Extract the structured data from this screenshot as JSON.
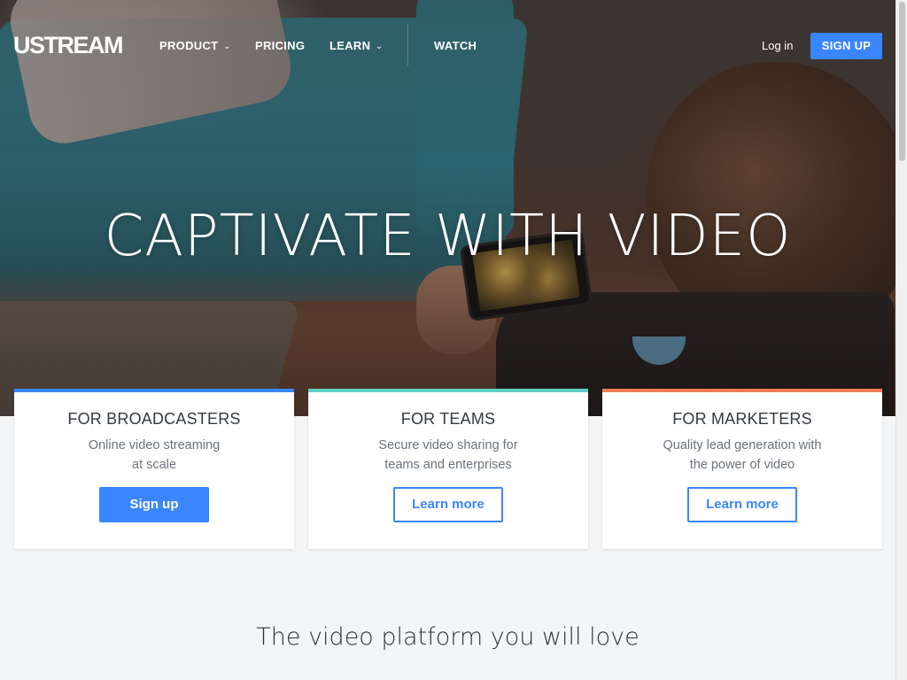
{
  "brand": {
    "logo_text": "USTREAM"
  },
  "nav": {
    "items": [
      {
        "label": "PRODUCT",
        "has_dropdown": true,
        "icon": "chevron-down-icon"
      },
      {
        "label": "PRICING",
        "has_dropdown": false
      },
      {
        "label": "LEARN",
        "has_dropdown": true,
        "icon": "chevron-down-icon"
      },
      {
        "label": "WATCH",
        "has_dropdown": false
      }
    ],
    "login_label": "Log in",
    "signup_label": "SIGN UP"
  },
  "hero": {
    "headline": "CAPTIVATE WITH VIDEO"
  },
  "cards": [
    {
      "title": "FOR BROADCASTERS",
      "description_line1": "Online video streaming",
      "description_line2": "at scale",
      "cta_label": "Sign up",
      "cta_style": "solid",
      "accent_color": "#3a86ff"
    },
    {
      "title": "FOR TEAMS",
      "description_line1": "Secure video sharing for",
      "description_line2": "teams and enterprises",
      "cta_label": "Learn more",
      "cta_style": "outline",
      "accent_color": "#5fcfc2"
    },
    {
      "title": "FOR MARKETERS",
      "description_line1": "Quality lead generation with",
      "description_line2": "the power of video",
      "cta_label": "Learn more",
      "cta_style": "outline",
      "accent_color": "#f27a54"
    }
  ],
  "section": {
    "title": "The video platform you will love"
  },
  "colors": {
    "primary": "#3a86ff",
    "page_background": "#f3f5f7",
    "text_dark": "#333a40",
    "text_muted": "#6b737a"
  }
}
